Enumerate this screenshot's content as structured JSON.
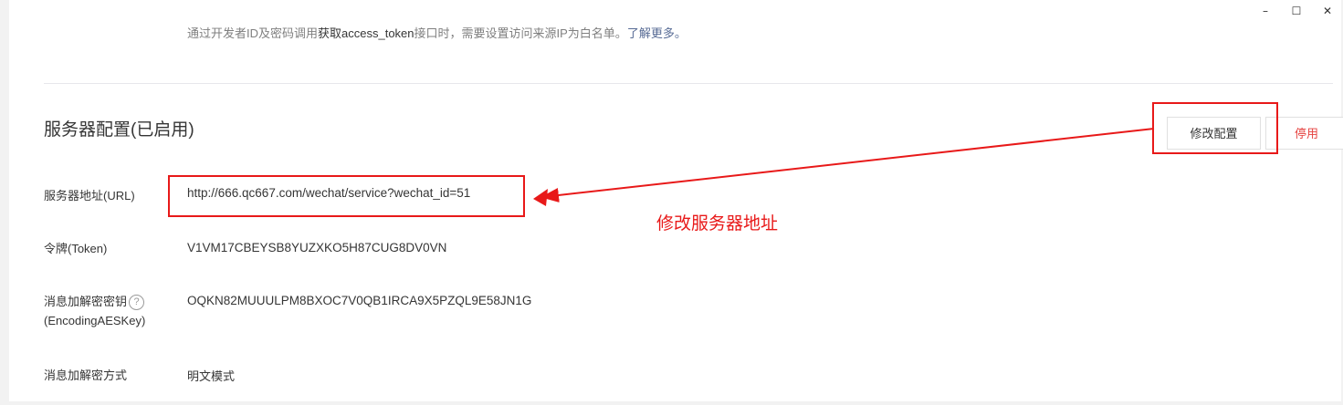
{
  "window_controls": {
    "minimize": "–",
    "maximize": "☐",
    "close": "✕"
  },
  "whitelist_note": {
    "prefix": "通过开发者ID及密码调用",
    "highlight": "获取access_token",
    "suffix": "接口时，需要设置访问来源IP为白名单。",
    "link": "了解更多。"
  },
  "server_config": {
    "title": "服务器配置(已启用)",
    "modify_button": "修改配置",
    "disable_button": "停用",
    "rows": {
      "url": {
        "label": "服务器地址(URL)",
        "value": "http://666.qc667.com/wechat/service?wechat_id=51"
      },
      "token": {
        "label": "令牌(Token)",
        "value": "V1VM17CBEYSB8YUZXKO5H87CUG8DV0VN"
      },
      "aes_key": {
        "label_line1": "消息加解密密钥",
        "label_line2": "(EncodingAESKey)",
        "help_icon": "?",
        "value": "OQKN82MUUULPM8BXOC7V0QB1IRCA9X5PZQL9E58JN1G"
      },
      "encrypt_mode": {
        "label": "消息加解密方式",
        "value": "明文模式"
      }
    }
  },
  "annotation": {
    "text": "修改服务器地址",
    "color": "#e81919"
  }
}
